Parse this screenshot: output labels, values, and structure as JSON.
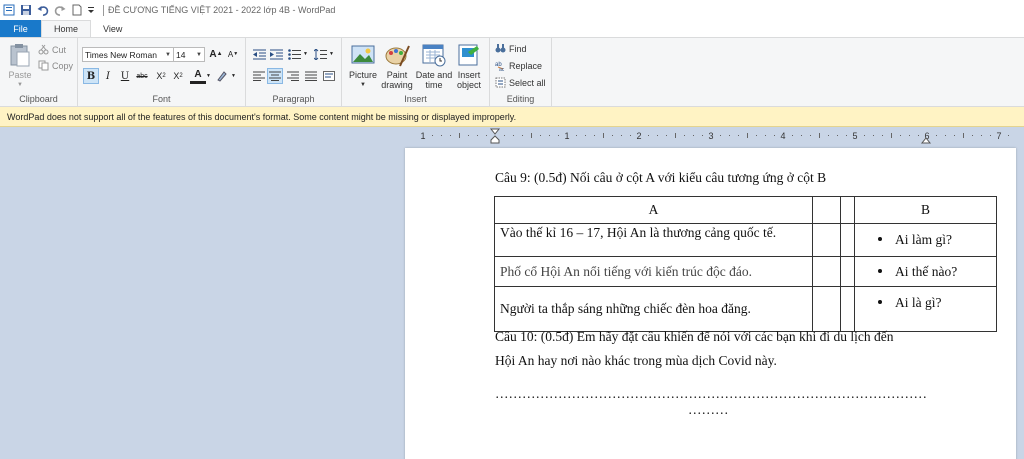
{
  "window": {
    "title": "ĐỀ CƯƠNG TIẾNG VIỆT 2021 - 2022 lớp 4B - WordPad"
  },
  "tabs": [
    {
      "label": "File"
    },
    {
      "label": "Home"
    },
    {
      "label": "View"
    }
  ],
  "ribbon": {
    "clipboard": {
      "label": "Clipboard",
      "paste": "Paste",
      "cut": "Cut",
      "copy": "Copy"
    },
    "font": {
      "label": "Font",
      "family": "Times New Roman",
      "size": "14"
    },
    "paragraph": {
      "label": "Paragraph"
    },
    "insert": {
      "label": "Insert",
      "picture": "Picture",
      "paint_line1": "Paint",
      "paint_line2": "drawing",
      "datetime_line1": "Date and",
      "datetime_line2": "time",
      "object_line1": "Insert",
      "object_line2": "object"
    },
    "editing": {
      "label": "Editing",
      "find": "Find",
      "replace": "Replace",
      "select_all": "Select all"
    }
  },
  "message_bar": "WordPad does not support all of the features of this document's format. Some content might be missing or displayed improperly.",
  "ruler": {
    "numbers": [
      "1",
      "1",
      "2",
      "3",
      "4",
      "5",
      "6",
      "7"
    ]
  },
  "document": {
    "q9": "Câu 9: (0.5đ) Nối câu ở cột A với kiểu câu tương ứng ở cột B",
    "table": {
      "header_a": "A",
      "header_b": "B",
      "rows": [
        {
          "a": "Vào thế kỉ 16 – 17, Hội An là thương cảng quốc tế.",
          "b": "Ai làm gì?"
        },
        {
          "a": "Phố cổ Hội An nổi tiếng với kiến trúc độc đáo.",
          "b": "Ai thế nào?"
        },
        {
          "a": "Người ta thắp sáng những chiếc đèn hoa đăng.",
          "b": "Ai là gì?"
        }
      ]
    },
    "q10_line1": "Câu 10: (0.5đ) Em hãy đặt câu khiến để nói với các bạn khi đi du lịch đến",
    "q10_line2": "Hội An hay nơi nào khác trong mùa dịch Covid này.",
    "dots_line1": "……………………………………………………………………………………",
    "dots_line2": "………"
  },
  "colors": {
    "file_tab": "#1979ca",
    "message_bar": "#fff3c4",
    "workspace": "#c9d5e6"
  }
}
